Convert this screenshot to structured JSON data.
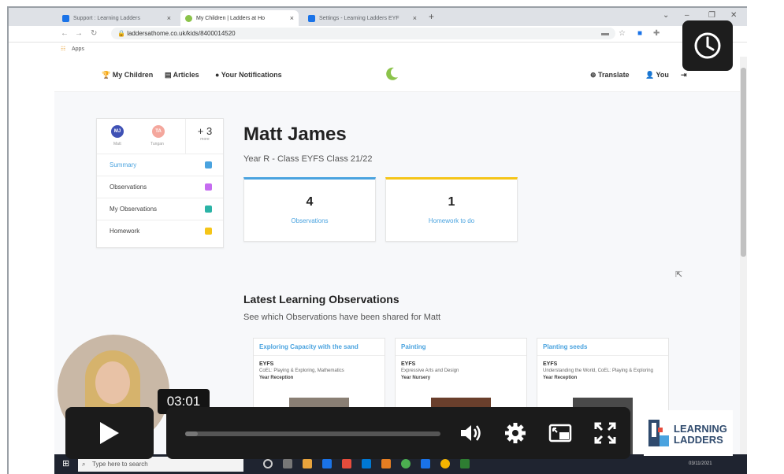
{
  "browser": {
    "tabs": [
      {
        "label": "Support : Learning Ladders",
        "color": "#1a73e8"
      },
      {
        "label": "My Children | Ladders at Ho",
        "color": "#8bc34a"
      },
      {
        "label": "Settings - Learning Ladders EYF",
        "color": "#1a73e8"
      }
    ],
    "new_tab": "+",
    "url": "laddersathome.co.uk/kids/8400014520",
    "bookmarks_label": "Apps"
  },
  "site": {
    "nav": {
      "children": "My Children",
      "articles": "Articles",
      "notifications": "Your Notifications",
      "translate": "Translate",
      "you": "You"
    }
  },
  "sidebar": {
    "children": [
      {
        "initials": "MJ",
        "name": "Matt",
        "color": "#3f51b5"
      },
      {
        "initials": "TA",
        "name": "Tungan",
        "color": "#f4a79d"
      }
    ],
    "more_count": "+ 3",
    "more_label": "more",
    "items": [
      {
        "label": "Summary",
        "icon": "summary-icon",
        "color": "#4aa3df",
        "active": true
      },
      {
        "label": "Observations",
        "icon": "observations-icon",
        "color": "#c56cf0",
        "active": false
      },
      {
        "label": "My Observations",
        "icon": "my-observations-icon",
        "color": "#2bb3a6",
        "active": false
      },
      {
        "label": "Homework",
        "icon": "homework-icon",
        "color": "#f5c518",
        "active": false
      }
    ]
  },
  "profile": {
    "name": "Matt James",
    "class": "Year R - Class EYFS Class 21/22",
    "stats": [
      {
        "value": "4",
        "label": "Observations",
        "accent": "#4aa3df"
      },
      {
        "value": "1",
        "label": "Homework to do",
        "accent": "#f5c518"
      }
    ]
  },
  "latest": {
    "title": "Latest Learning Observations",
    "subtitle": "See which Observations have been shared for Matt",
    "cards": [
      {
        "title": "Exploring Capacity with the sand",
        "kind": "EYFS",
        "desc": "CoEL: Playing & Exploring, Mathematics",
        "year": "Year Reception"
      },
      {
        "title": "Painting",
        "kind": "EYFS",
        "desc": "Expressive Arts and Design",
        "year": "Year Nursery"
      },
      {
        "title": "Planting seeds",
        "kind": "EYFS",
        "desc": "Understanding the World, CoEL: Playing & Exploring",
        "year": "Year Reception"
      }
    ]
  },
  "taskbar": {
    "search_placeholder": "Type here to search",
    "date": "03/11/2021"
  },
  "video": {
    "timestamp": "03:01",
    "progress": 0.05,
    "logo_line1": "LEARNING",
    "logo_line2": "LADDERS"
  }
}
